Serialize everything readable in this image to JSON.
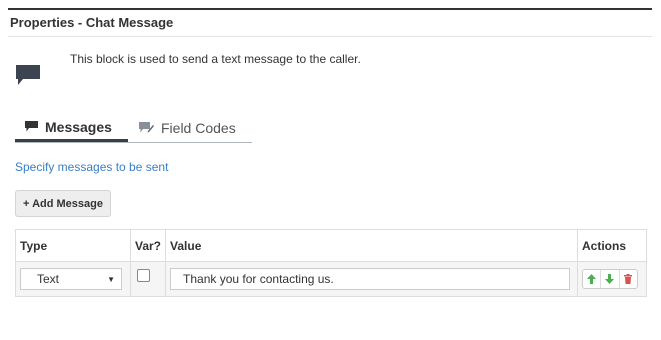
{
  "panel": {
    "title": "Properties - Chat Message",
    "description": "This block is used to send a text message to the caller."
  },
  "tabs": [
    {
      "label": "Messages",
      "icon": "chat-bubble-icon",
      "active": true
    },
    {
      "label": "Field Codes",
      "icon": "pencil-chat-icon",
      "active": false
    }
  ],
  "hint": "Specify messages to be sent",
  "add_button": {
    "label": "+ Add Message"
  },
  "table": {
    "headers": {
      "type": "Type",
      "var": "Var?",
      "value": "Value",
      "actions": "Actions"
    },
    "rows": [
      {
        "type": "Text",
        "var_checked": false,
        "value": "Thank you for contacting us."
      }
    ]
  },
  "colors": {
    "link": "#3a7fc4",
    "move_arrows": "#4caf50",
    "delete": "#d9534f"
  }
}
